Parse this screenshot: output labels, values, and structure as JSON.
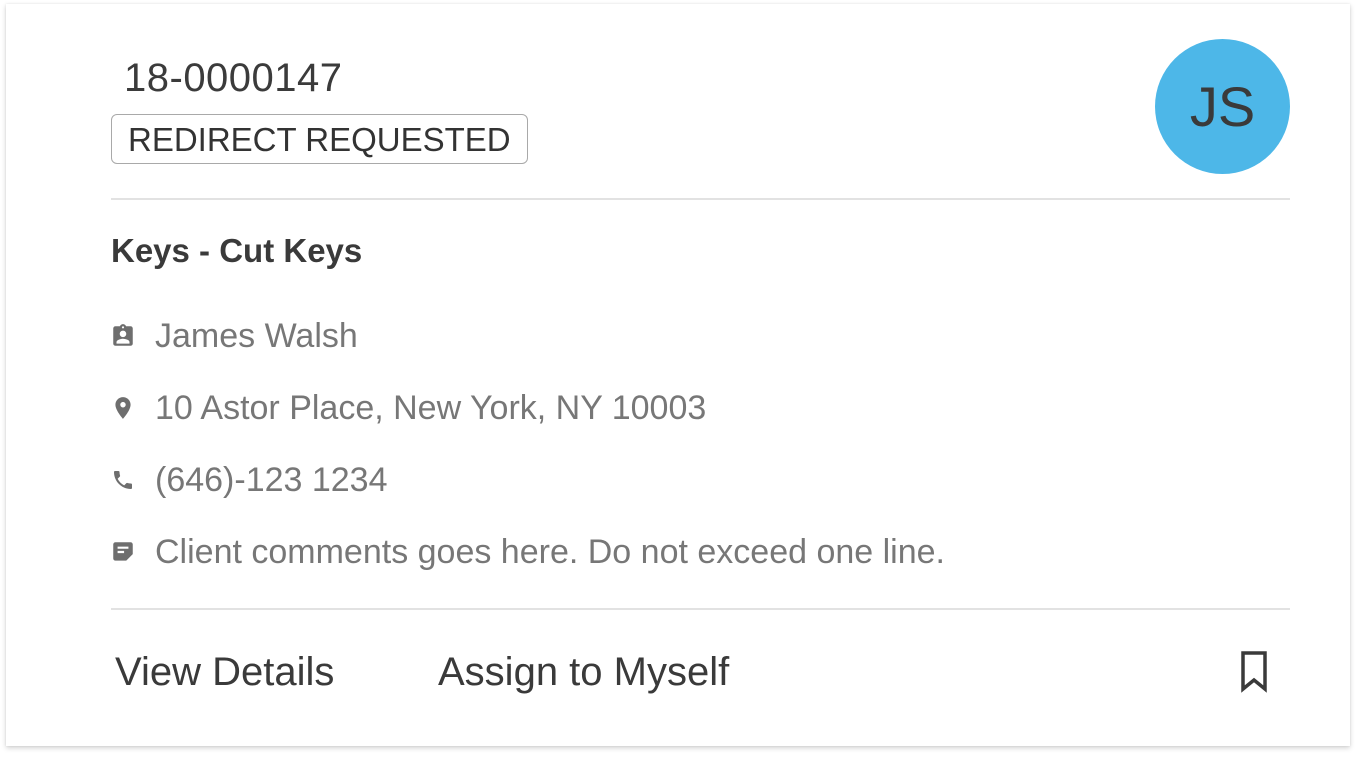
{
  "ticket": {
    "id": "18-0000147",
    "status": "REDIRECT REQUESTED",
    "service": "Keys - Cut Keys"
  },
  "avatar": {
    "initials": "JS",
    "color": "#4db7e8"
  },
  "client": {
    "name": "James Walsh",
    "name_icon": "assignment-ind-icon",
    "address": "10 Astor Place, New York, NY 10003",
    "address_icon": "location-pin-icon",
    "phone": "(646)-123 1234",
    "phone_icon": "phone-icon",
    "comment": "Client comments goes here. Do not exceed one line.",
    "comment_icon": "note-icon"
  },
  "actions": {
    "view_details": "View Details",
    "assign": "Assign to Myself",
    "bookmark_icon": "bookmark-outline-icon"
  }
}
